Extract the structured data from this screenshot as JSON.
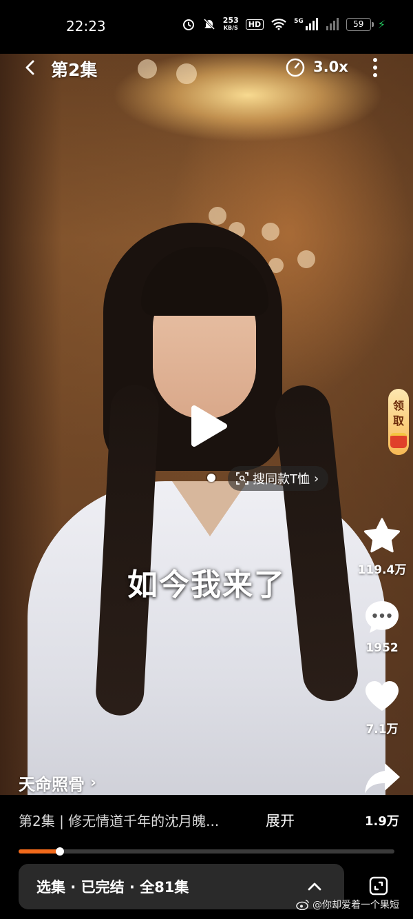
{
  "status_bar": {
    "time": "22:23",
    "net_speed_value": "253",
    "net_speed_unit": "KB/S",
    "hd_label": "HD",
    "signal_label": "5G",
    "battery_level": "59"
  },
  "top_bar": {
    "episode_title": "第2集",
    "speed_label": "3.0x"
  },
  "video": {
    "subtitle": "如今我来了",
    "search_tag": "搜同款T恤",
    "claim_widget_text": [
      "领",
      "取"
    ]
  },
  "side_actions": {
    "favorite_count": "119.4万",
    "comment_count": "1952",
    "like_count": "7.1万",
    "share_count": "1.9万"
  },
  "drama": {
    "name": "天命照骨",
    "episode_description": "第2集 | 修无情道千年的沈月魄...",
    "expand_label": "展开"
  },
  "playback": {
    "progress_fraction": 0.11
  },
  "episode_panel": {
    "label": "选集 · 已完结 · 全81集"
  },
  "watermark": "@你却爱着一个果短",
  "colors": {
    "accent": "#f26a1b",
    "panel_bg": "#2a2a2a"
  }
}
